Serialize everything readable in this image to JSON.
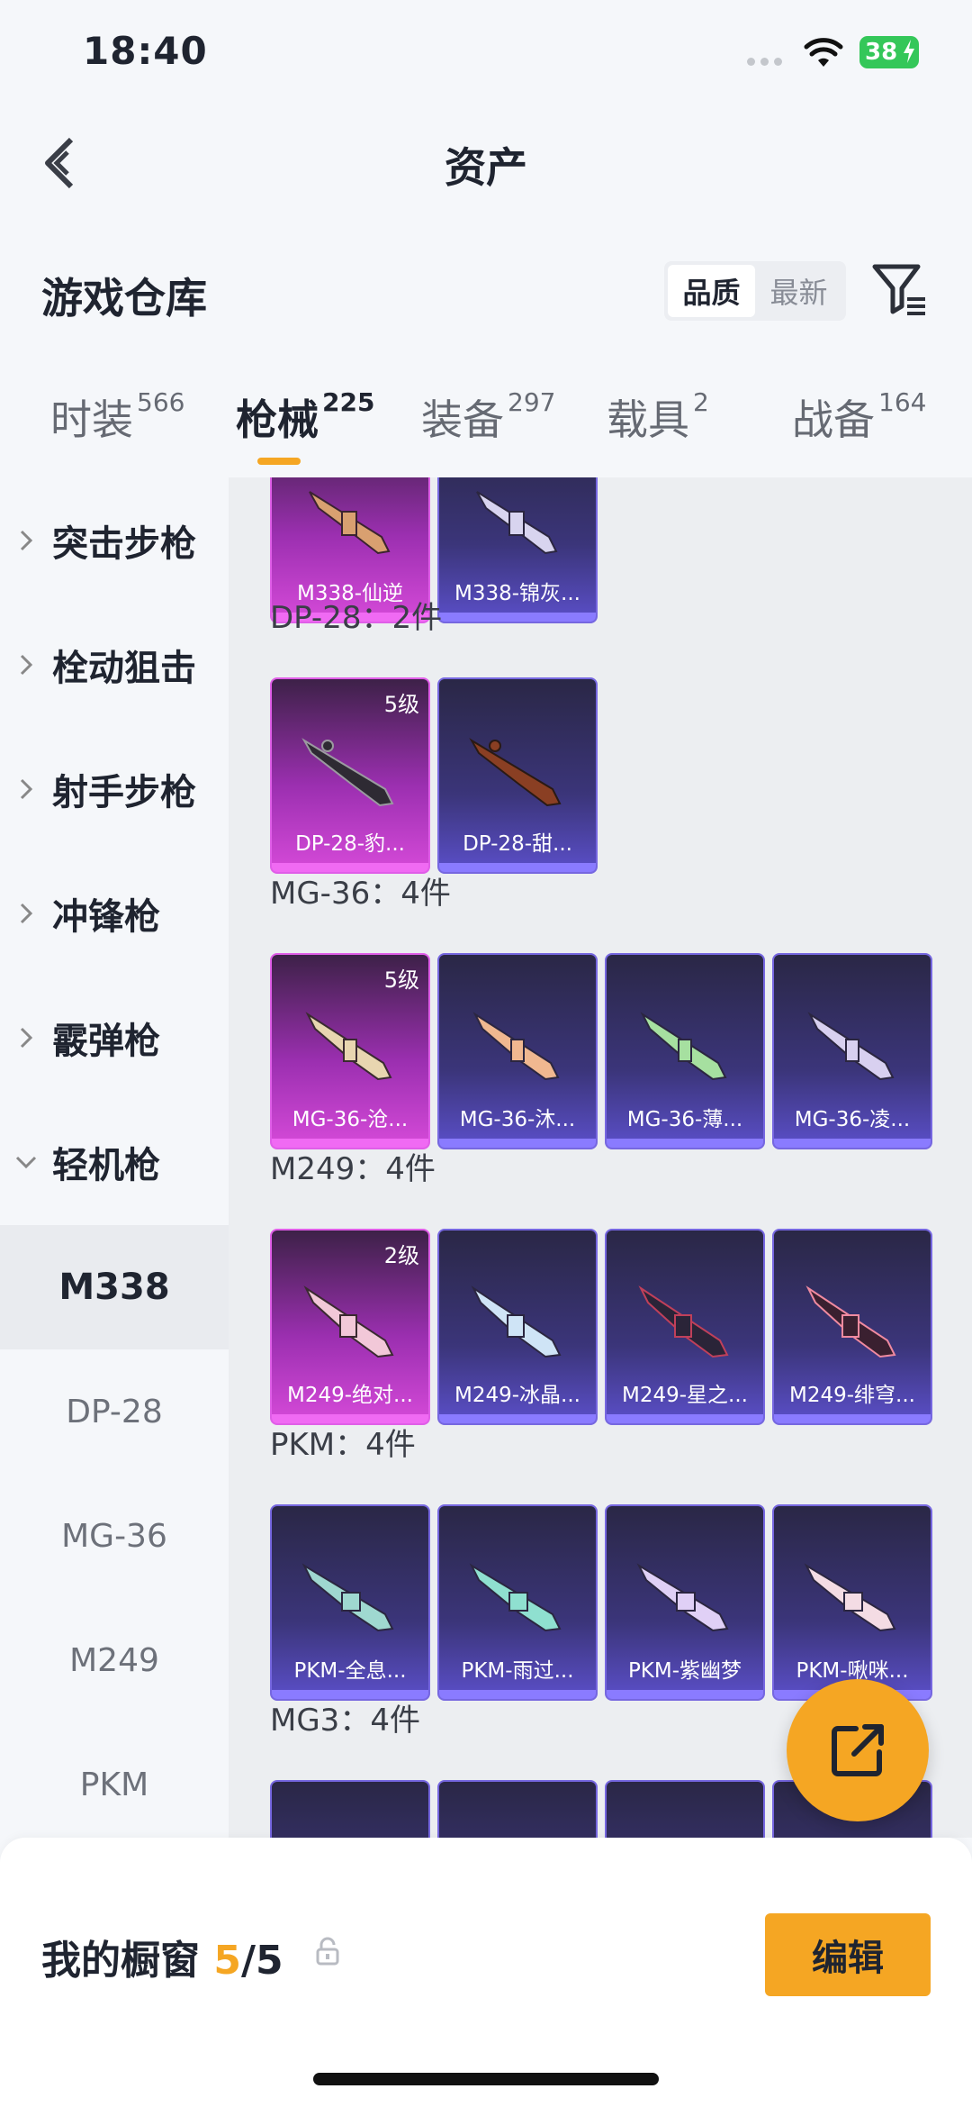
{
  "status": {
    "time": "18:40",
    "battery": "38"
  },
  "header": {
    "title": "资产"
  },
  "warehouse": {
    "title": "游戏仓库",
    "sort_quality": "品质",
    "sort_latest": "最新"
  },
  "tabs": [
    {
      "label": "时装",
      "count": "566"
    },
    {
      "label": "枪械",
      "count": "225"
    },
    {
      "label": "装备",
      "count": "297"
    },
    {
      "label": "载具",
      "count": "2"
    },
    {
      "label": "战备",
      "count": "164"
    }
  ],
  "sidebar": {
    "categories": [
      "突击步枪",
      "栓动狙击",
      "射手步枪",
      "冲锋枪",
      "霰弹枪",
      "轻机枪"
    ],
    "subitems": [
      "M338",
      "DP-28",
      "MG-36",
      "M249",
      "PKM"
    ]
  },
  "groups": [
    {
      "title": "",
      "items": [
        {
          "label": "M338-仙逆"
        },
        {
          "label": "M338-锦灰..."
        }
      ]
    },
    {
      "title": "DP-28：2件",
      "items": [
        {
          "label": "DP-28-豹...",
          "level": "5级"
        },
        {
          "label": "DP-28-甜..."
        }
      ]
    },
    {
      "title": "MG-36：4件",
      "items": [
        {
          "label": "MG-36-沧...",
          "level": "5级"
        },
        {
          "label": "MG-36-沐..."
        },
        {
          "label": "MG-36-薄..."
        },
        {
          "label": "MG-36-凌..."
        }
      ]
    },
    {
      "title": "M249：4件",
      "items": [
        {
          "label": "M249-绝对...",
          "level": "2级"
        },
        {
          "label": "M249-冰晶..."
        },
        {
          "label": "M249-星之..."
        },
        {
          "label": "M249-绯穹..."
        }
      ]
    },
    {
      "title": "PKM：4件",
      "items": [
        {
          "label": "PKM-全息..."
        },
        {
          "label": "PKM-雨过..."
        },
        {
          "label": "PKM-紫幽梦"
        },
        {
          "label": "PKM-啾咪..."
        }
      ]
    },
    {
      "title": "MG3：4件",
      "items": []
    }
  ],
  "bottom": {
    "showcase_label": "我的橱窗",
    "showcase_count": "5",
    "showcase_total": "/5",
    "edit_label": "编辑"
  },
  "colors": {
    "accent": "#f5a623",
    "epic_purple": "#d64ad9",
    "rare_indigo": "#5b4fc9"
  }
}
